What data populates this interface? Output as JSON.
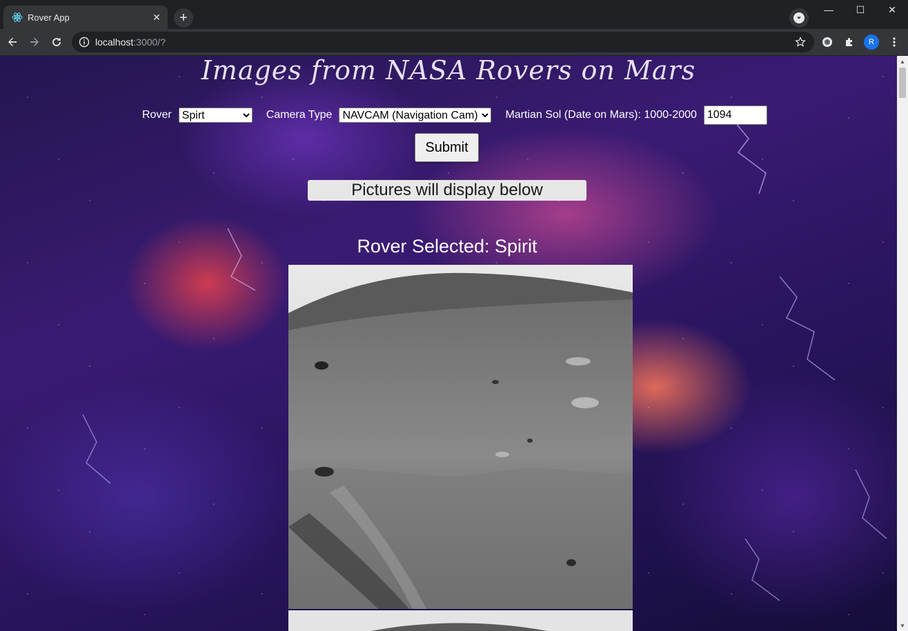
{
  "browser": {
    "tab_title": "Rover App",
    "url_host": "localhost",
    "url_path": ":3000/?",
    "profile_initial": "R",
    "new_tab_glyph": "+",
    "close_glyph": "✕",
    "minimize_glyph": "—",
    "maximize_glyph": "☐",
    "window_close_glyph": "✕"
  },
  "page": {
    "title": "Images from NASA Rovers on Mars",
    "form": {
      "rover_label": "Rover",
      "rover_selected": "Spirt",
      "camera_label": "Camera Type",
      "camera_selected": "NAVCAM (Navigation Cam)",
      "sol_label": "Martian Sol (Date on Mars): 1000-2000",
      "sol_value": "1094",
      "submit_label": "Submit"
    },
    "notice": "Pictures will display below",
    "selected_heading": "Rover Selected: Spirit"
  },
  "colors": {
    "accent": "#1a73e8",
    "chrome_dark": "#202124",
    "chrome_tab": "#35363a"
  }
}
